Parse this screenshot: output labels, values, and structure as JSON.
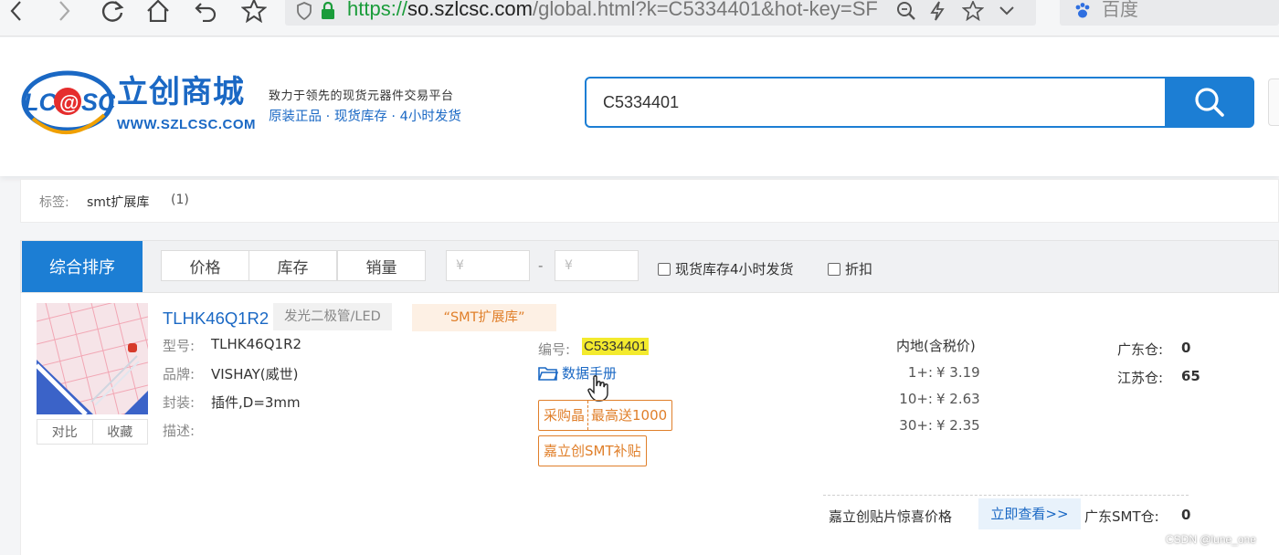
{
  "browser": {
    "url_scheme": "https://",
    "url_domain": "so.szlcsc.com",
    "url_path": "/global.html?k=C5334401&hot-key=SF",
    "search_engine": "百度",
    "icons": [
      "back-icon",
      "forward-icon",
      "reload-icon",
      "home-icon",
      "undo-icon",
      "bookmark-star-icon",
      "shield-icon",
      "lock-icon",
      "zoom-icon",
      "lightning-icon",
      "star-icon",
      "chevron-down-icon",
      "paw-icon"
    ]
  },
  "header": {
    "brand_cn": "立创商城",
    "brand_url": "WWW.SZLCSC.COM",
    "slogan_top": "致力于领先的现货元器件交易平台",
    "slogan_bottom": "原装正品 · 现货库存 · 4小时发货",
    "search_value": "C5334401",
    "brand_color": "#1a68c4",
    "accent_color": "#1c7ed4"
  },
  "tags": {
    "label": "标签:",
    "value": "smt扩展库",
    "count": "(1)"
  },
  "sort_bar": {
    "active": "综合排序",
    "tabs": [
      "价格",
      "库存",
      "销量"
    ],
    "price_min_placeholder": "¥",
    "price_max_placeholder": "¥",
    "dash": "-",
    "filter_stock": "现货库存4小时发货",
    "filter_discount": "折扣"
  },
  "product": {
    "name": "TLHK46Q1R2",
    "category": "发光二极管/LED",
    "tag": "“SMT扩展库”",
    "compare": "对比",
    "favorite": "收藏",
    "attrs": [
      {
        "label": "型号:",
        "value": "TLHK46Q1R2"
      },
      {
        "label": "品牌:",
        "value": "VISHAY(威世)"
      },
      {
        "label": "封装:",
        "value": "插件,D=3mm"
      },
      {
        "label": "描述:",
        "value": ""
      }
    ],
    "code_label": "编号:",
    "code_value": "C5334401",
    "datasheet": "数据手册",
    "promo1_left": "采购晶",
    "promo1_right": "最高送1000",
    "promo2": "嘉立创SMT补贴",
    "price_head": "内地(含税价)",
    "price_tiers": [
      {
        "qty": "1+:",
        "price": "¥ 3.19"
      },
      {
        "qty": "10+:",
        "price": "¥ 2.63"
      },
      {
        "qty": "30+:",
        "price": "¥ 2.35"
      }
    ],
    "stock": [
      {
        "label": "广东仓:",
        "value": "0"
      },
      {
        "label": "江苏仓:",
        "value": "65"
      }
    ],
    "smt_offer": "嘉立创贴片惊喜价格",
    "smt_link": "立即查看>>",
    "smt_stock_label": "广东SMT仓:",
    "smt_stock_value": "0"
  },
  "watermark": "CSDN @lune_one"
}
